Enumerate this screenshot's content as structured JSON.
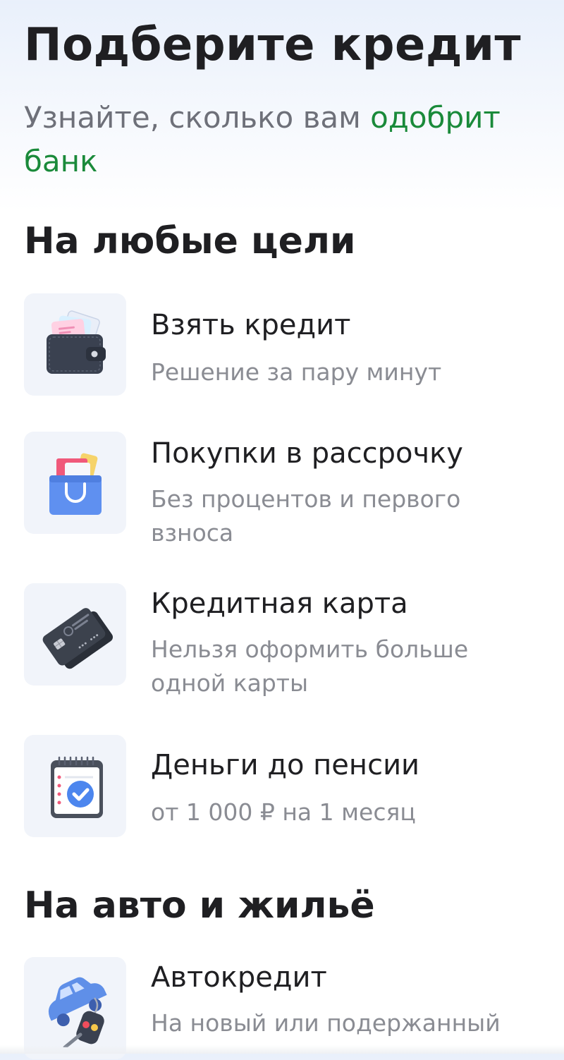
{
  "header": {
    "title": "Подберите кредит",
    "subtitle_plain": "Узнайте, сколько вам ",
    "subtitle_accent": "одобрит банк"
  },
  "sections": [
    {
      "title": "На любые цели",
      "items": [
        {
          "title": "Взять кредит",
          "description": "Решение за пару минут",
          "icon": "wallet-icon"
        },
        {
          "title": "Покупки в рассрочку",
          "description": "Без процентов и первого взноса",
          "icon": "shopping-bag-icon"
        },
        {
          "title": "Кредитная карта",
          "description": "Нельзя оформить больше одной карты",
          "icon": "credit-card-icon"
        },
        {
          "title": "Деньги до пенсии",
          "description": "от 1 000 ₽ на 1 месяц",
          "icon": "calendar-check-icon"
        }
      ]
    },
    {
      "title": "На авто и жильё",
      "items": [
        {
          "title": "Автокредит",
          "description": "На новый или подержанный",
          "icon": "car-key-icon"
        }
      ]
    }
  ],
  "colors": {
    "accent": "#1a8a3a",
    "text": "#1f1f22",
    "muted": "#8a8c93",
    "tile": "#f1f4fa"
  }
}
